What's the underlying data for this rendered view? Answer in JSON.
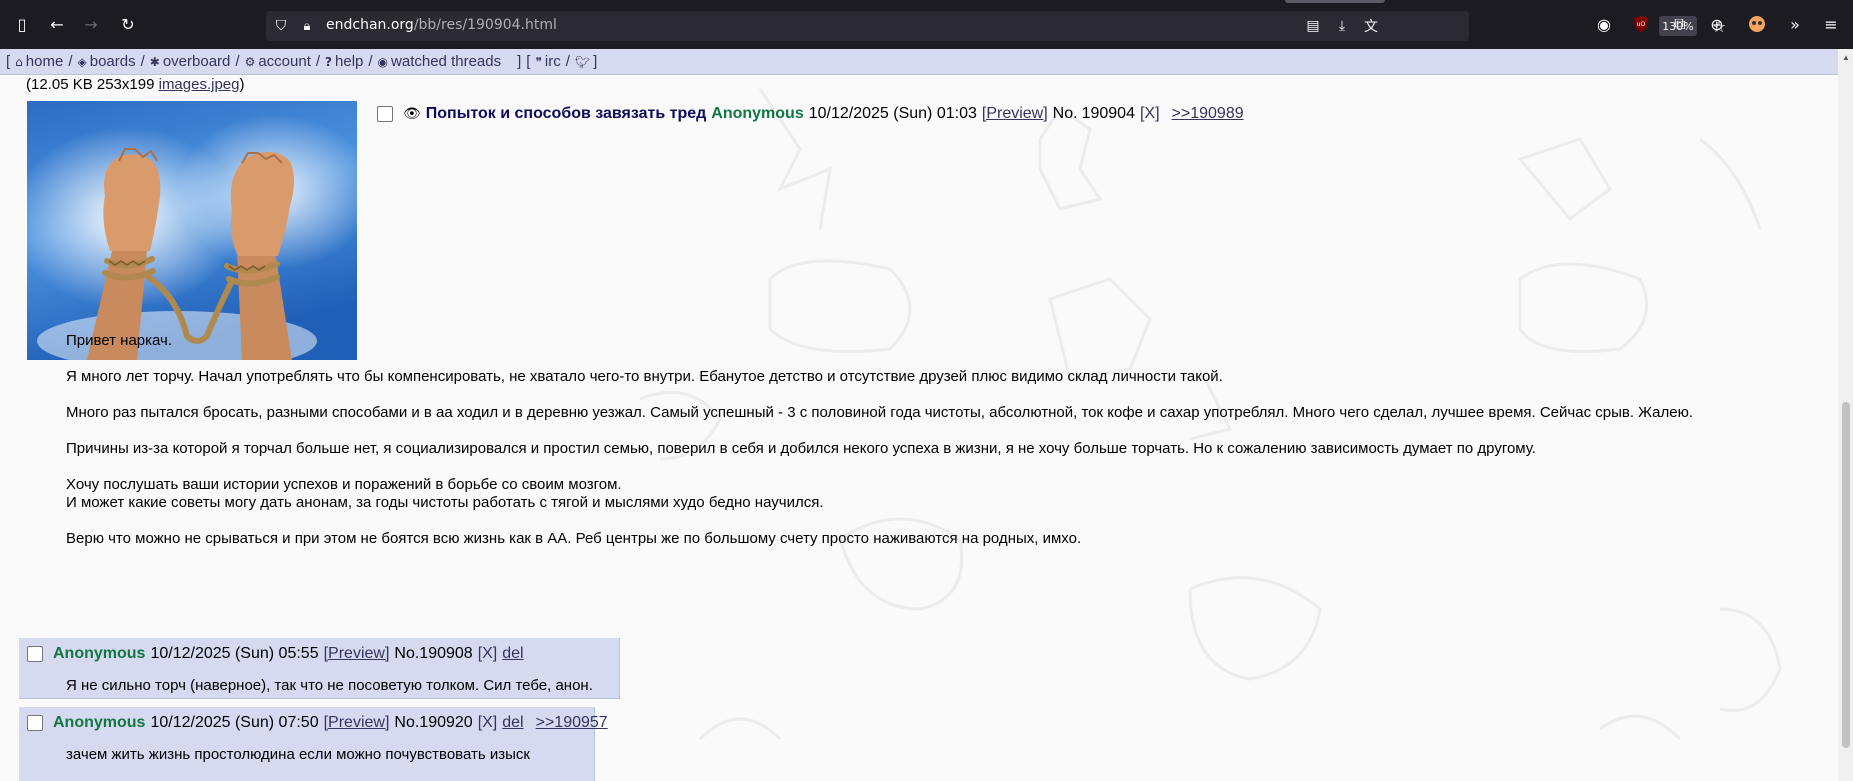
{
  "browser": {
    "url_host": "endchan.org",
    "url_path": "/bb/res/190904.html",
    "zoom": "130%"
  },
  "nav": {
    "home": "home",
    "boards": "boards",
    "overboard": "overboard",
    "account": "account",
    "help": "help",
    "watched": "watched threads",
    "irc": "irc"
  },
  "op": {
    "file_info_meta": "(12.05 KB 253x199",
    "file_name": "images.jpeg",
    "subject": "Попыток и способов завязать тред",
    "name": "Anonymous",
    "date": "10/12/2025 (Sun) 01:03",
    "preview": "[Preview]",
    "no_label": "No.",
    "no": "190904",
    "hide": "[X]",
    "backlink": ">>190989",
    "paragraphs": [
      "Привет наркач.",
      "Я много лет торчу. Начал употреблять что бы компенсировать, не хватало чего-то внутри. Ебанутое детство и отсутствие друзей плюс видимо склад личности такой.",
      "Много раз пытался бросать, разными способами и в аа ходил и в деревню уезжал. Самый успешный - 3 с половиной года чистоты, абсолютной, ток кофе и сахар употреблял. Много чего сделал, лучшее время. Сейчас срыв. Жалею.",
      "Причины из-за которой я торчал больше нет, я социализировался и простил семью, поверил в себя и добился некого успеха в жизни, я не хочу больше торчать. Но к сожалению зависимость думает по другому."
    ],
    "paragraph_multi": [
      "Хочу послушать ваши истории успехов и поражений в борьбе со своим мозгом.",
      "И может какие советы могу дать анонам, за годы чистоты работать с тягой и мыслями худо бедно научился."
    ],
    "paragraph_last": "Верю что можно не срываться и при этом не боятся всю жизнь как в АА. Реб центры же по большому счету просто наживаются на родных, имхо."
  },
  "replies": [
    {
      "name": "Anonymous",
      "date": "10/12/2025 (Sun) 05:55",
      "preview": "[Preview]",
      "no": "No.190908",
      "hide": "[X]",
      "del": "del",
      "backlink": "",
      "body": "Я не сильно торч (наверное), так что не посоветую толком. Сил тебе, анон."
    },
    {
      "name": "Anonymous",
      "date": "10/12/2025 (Sun) 07:50",
      "preview": "[Preview]",
      "no": "No.190920",
      "hide": "[X]",
      "del": "del",
      "backlink": ">>190957",
      "body": "зачем жить жизнь простолюдина если можно почувствовать изыск"
    }
  ],
  "colors": {
    "subject": "#0f0c5d",
    "name": "#117743",
    "reply_bg": "#d6daf0",
    "nav_bg": "#d6daf0"
  }
}
